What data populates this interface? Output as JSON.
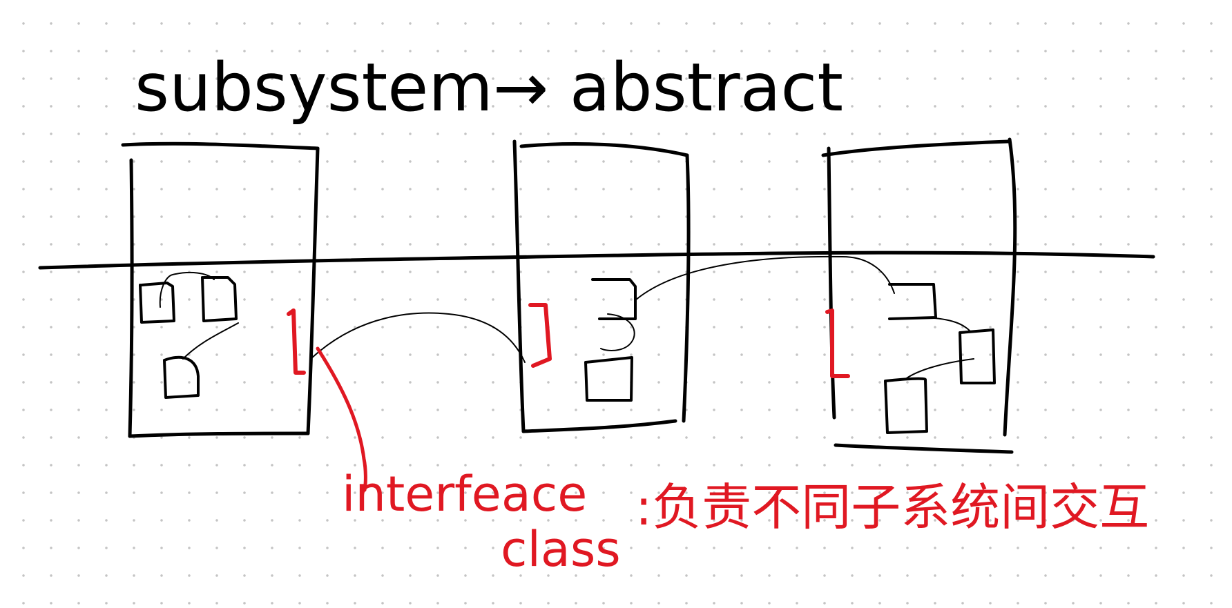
{
  "title": "subsystem→ abstract",
  "note_label": "interfeace\nclass",
  "note_label_line1": "interfeace",
  "note_label_line2": "class",
  "note_desc": ":负责不同子系统间交互",
  "colors": {
    "ink": "#000000",
    "accent": "#e01822",
    "grid_dot": "#c4c4c4"
  }
}
